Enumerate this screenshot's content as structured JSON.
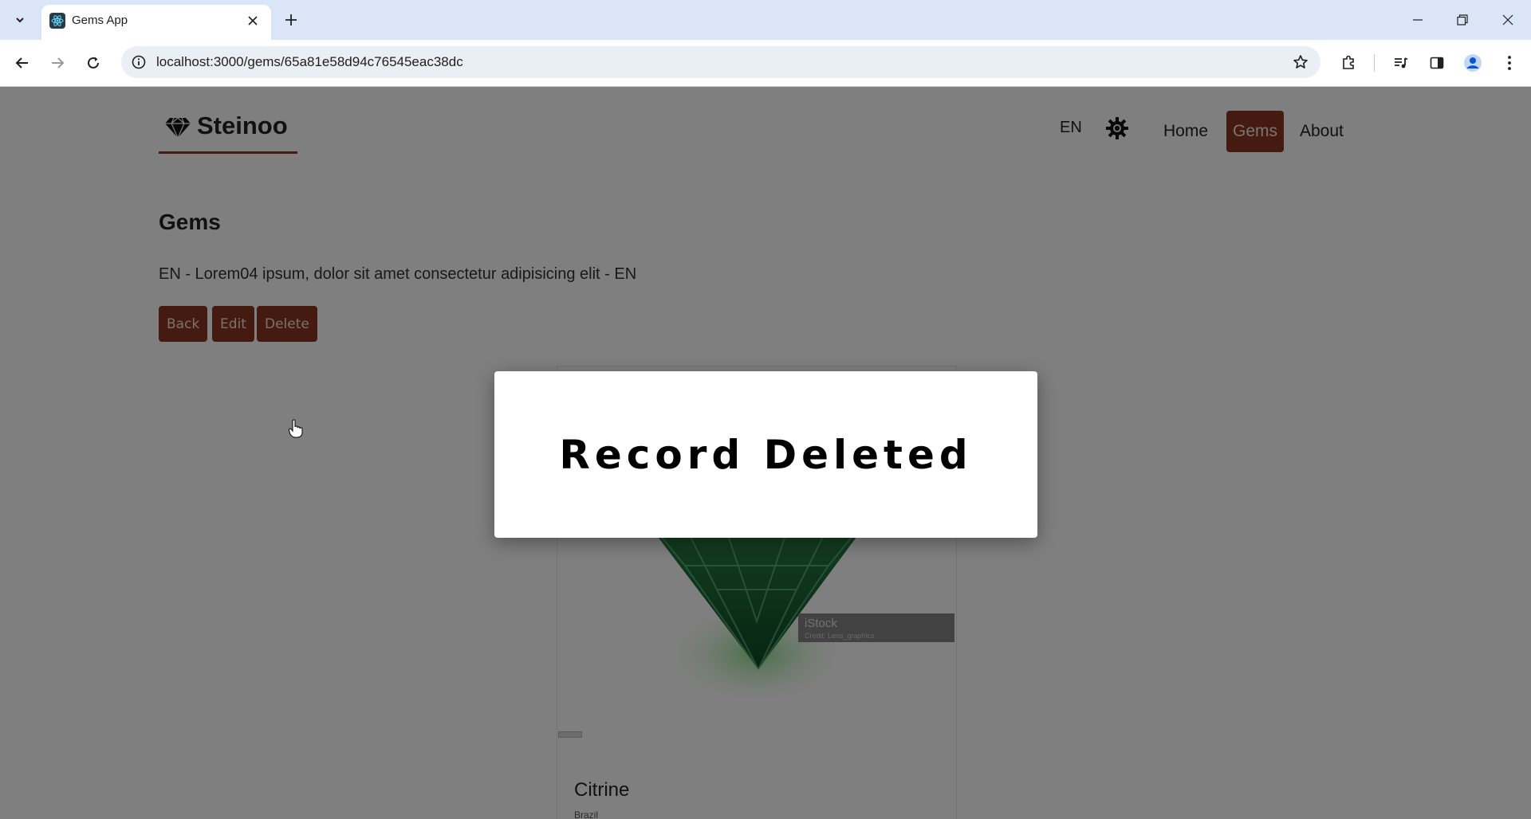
{
  "browser": {
    "tab_title": "Gems App",
    "url": "localhost:3000/gems/65a81e58d94c76545eac38dc"
  },
  "navbar": {
    "brand": "Steinoo",
    "language": "EN",
    "links": [
      {
        "label": "Home",
        "active": false
      },
      {
        "label": "Gems",
        "active": true
      },
      {
        "label": "About",
        "active": false
      }
    ]
  },
  "main": {
    "title": "Gems",
    "description": "EN - Lorem04 ipsum, dolor sit amet consectetur adipisicing elit - EN",
    "buttons": {
      "back": "Back",
      "edit": "Edit",
      "delete": "Delete"
    }
  },
  "card": {
    "name": "Citrine",
    "origin": "Brazil",
    "watermark_brand": "iStock",
    "watermark_credit": "Credit: Lens_graphics"
  },
  "modal": {
    "message": "Record Deleted"
  },
  "colors": {
    "accent": "#8b3521",
    "tabbar": "#dae5f8",
    "gem_green": "#1f7a3a"
  }
}
